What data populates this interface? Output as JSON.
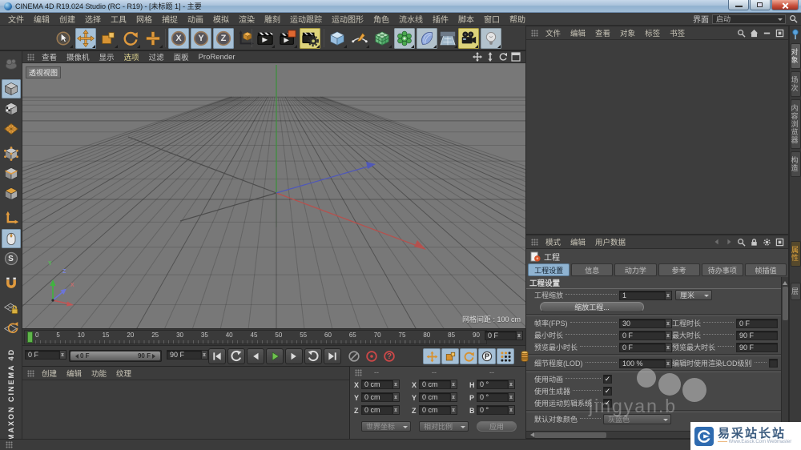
{
  "window": {
    "title": "CINEMA 4D R19.024 Studio (RC - R19) - [未标题 1] - 主要",
    "controls": [
      "minimize",
      "restore",
      "close"
    ]
  },
  "menu_bar": {
    "items": [
      "文件",
      "编辑",
      "创建",
      "选择",
      "工具",
      "网格",
      "捕捉",
      "动画",
      "模拟",
      "渲染",
      "雕刻",
      "运动跟踪",
      "运动图形",
      "角色",
      "流水线",
      "插件",
      "脚本",
      "窗口",
      "帮助"
    ],
    "interface_label": "界面",
    "interface_value": "启动"
  },
  "toolbar": {
    "icons": [
      "live-selection",
      "move",
      "scale",
      "rotate",
      "last-tool",
      "lock-x",
      "lock-y",
      "lock-z",
      "coordinate-system",
      "render-view",
      "render-region",
      "render-settings",
      "add-cube",
      "add-spline",
      "add-subdivision",
      "add-mograph",
      "add-field",
      "add-floor",
      "add-camera",
      "add-light"
    ],
    "axis_x": "X",
    "axis_y": "Y",
    "axis_z": "Z"
  },
  "mode_bar": {
    "icons": [
      "sculpt",
      "model-mode",
      "texture-mode",
      "uv-mode",
      "points-mode",
      "edges-mode",
      "polygons-mode",
      "axis-mode",
      "viewport-solo",
      "snap",
      "magnet",
      "lock-workplane",
      "rotate-workplane"
    ],
    "snap_letter": "S"
  },
  "viewport": {
    "menu": [
      "查看",
      "摄像机",
      "显示",
      "选项",
      "过滤",
      "面板",
      "ProRender"
    ],
    "view_label": "透视视图",
    "grid_spacing": "网格间距 : 100 cm",
    "axis_x": "X",
    "axis_y": "Y",
    "axis_z": "Z"
  },
  "object_manager": {
    "menu": [
      "文件",
      "编辑",
      "查看",
      "对象",
      "标签",
      "书签"
    ]
  },
  "right_dock": {
    "top_tabs": [
      "对象",
      "场次",
      "内容浏览器",
      "构造"
    ],
    "bottom_tabs": [
      "属性",
      "层"
    ]
  },
  "attribute_manager": {
    "menu": [
      "模式",
      "编辑",
      "用户数据"
    ],
    "object_title": "工程",
    "tabs": [
      "工程设置",
      "信息",
      "动力学",
      "参考",
      "待办事项",
      "帧插值"
    ],
    "active_tab": "工程设置",
    "section_title": "工程设置",
    "project_scale": {
      "label": "工程缩放",
      "value": "1",
      "unit": "厘米"
    },
    "scale_project_button": "缩放工程...",
    "fps": {
      "label": "帧率(FPS)",
      "value": "30"
    },
    "project_time": {
      "label": "工程时长",
      "value": "0 F"
    },
    "min_time": {
      "label": "最小时长",
      "value": "0 F"
    },
    "max_time": {
      "label": "最大时长",
      "value": "90 F"
    },
    "preview_min_time": {
      "label": "预览最小时长",
      "value": "0 F"
    },
    "preview_max_time": {
      "label": "预览最大时长",
      "value": "90 F"
    },
    "lod": {
      "label": "细节程度(LOD)",
      "value": "100 %"
    },
    "render_lod": {
      "label": "编辑时使用渲染LOD级别",
      "checked": false
    },
    "use_animation": {
      "label": "使用动画",
      "checked": true
    },
    "use_generators": {
      "label": "使用生成器",
      "checked": true
    },
    "use_motion_system": {
      "label": "使用运动剪辑系统",
      "checked": true
    },
    "default_color": {
      "label": "默认对象颜色",
      "value": "灰蓝色"
    }
  },
  "timeline": {
    "ticks": [
      "0",
      "5",
      "10",
      "15",
      "20",
      "25",
      "30",
      "35",
      "40",
      "45",
      "50",
      "55",
      "60",
      "65",
      "70",
      "75",
      "80",
      "85",
      "90"
    ],
    "current_frame": "0 F"
  },
  "transport": {
    "start_frame": "0 F",
    "range_start": "0 F",
    "range_end": "90 F",
    "end_frame": "90 F",
    "buttons": [
      "goto-start",
      "previous-key",
      "previous-frame",
      "play",
      "next-frame",
      "next-key",
      "goto-end",
      "record-disabled",
      "autokey",
      "keyframe-help",
      "key-position",
      "key-scale",
      "key-rotation",
      "key-parameter",
      "point-level-animation",
      "keyframe-selection"
    ],
    "parameter_letter": "P",
    "help_glyph": "?"
  },
  "material_manager": {
    "menu": [
      "创建",
      "编辑",
      "功能",
      "纹理"
    ]
  },
  "coordinate_manager": {
    "headers": [
      "--",
      "--",
      "--"
    ],
    "rows": [
      {
        "l1": "X",
        "v1": "0 cm",
        "l2": "X",
        "v2": "0 cm",
        "l3": "H",
        "v3": "0 °"
      },
      {
        "l1": "Y",
        "v1": "0 cm",
        "l2": "Y",
        "v2": "0 cm",
        "l3": "P",
        "v3": "0 °"
      },
      {
        "l1": "Z",
        "v1": "0 cm",
        "l2": "Z",
        "v2": "0 cm",
        "l3": "B",
        "v3": "0 °"
      }
    ],
    "mode_left": "世界坐标",
    "mode_middle": "相对比例",
    "apply_button": "应用"
  },
  "branding": {
    "vertical_text": "MAXON CINEMA 4D"
  },
  "watermark": {
    "faint_text": "jingyan.b",
    "site_name": "易采站长站",
    "site_subtitle": "Www.Easck.Com Webmaster"
  },
  "colors": {
    "selection_blue": "#a6c0d6",
    "toggle_yellow": "#ddd37b",
    "axis_x_red": "#b5514e",
    "axis_y_green": "#3f8f3f",
    "axis_z_blue": "#5058b8",
    "play_green": "#6fc24f",
    "record_red": "#cc4848",
    "tool_orange": "#e09a3e",
    "watermark_blue": "#2e6bb0"
  }
}
